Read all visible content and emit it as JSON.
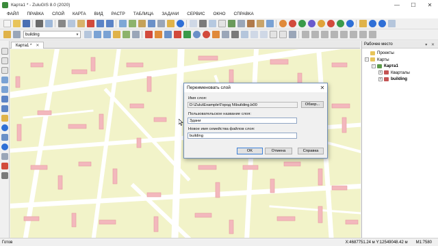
{
  "window": {
    "title": "Карта1 * - ZuluGIS 8.0 (2020)",
    "controls": [
      "—",
      "☐",
      "✕"
    ]
  },
  "menu": [
    "ФАЙЛ",
    "ПРАВКА",
    "СЛОЙ",
    "КАРТА",
    "ВИД",
    "РАСТР",
    "ТАБЛИЦА",
    "ЗАДАЧИ",
    "СЕРВИС",
    "ОКНО",
    "СПРАВКА"
  ],
  "toolbar": {
    "layer_combo_value": "building"
  },
  "tab": {
    "label": "Карта1 *",
    "close": "✕"
  },
  "workspace": {
    "title": "Рабочее место",
    "controls": "▾ ✕",
    "tree": [
      {
        "label": "Проекты",
        "level": 0,
        "toggle": "",
        "icon": "folder-icon"
      },
      {
        "label": "Карты",
        "level": 0,
        "toggle": "−",
        "icon": "folder-icon"
      },
      {
        "label": "Карта1",
        "level": 1,
        "toggle": "−",
        "icon": "map-icon",
        "bold": true
      },
      {
        "label": "Кварталы",
        "level": 2,
        "toggle": "+",
        "icon": "layer-icon"
      },
      {
        "label": "building",
        "level": 2,
        "toggle": "+",
        "icon": "layer-icon",
        "bold": true
      }
    ]
  },
  "dialog": {
    "title": "Переименовать слой",
    "layer_name_label": "Имя слоя:",
    "layer_name_value": "D:\\Zulu\\Example\\Город N\\building.b00",
    "browse_button": "Обзор...",
    "custom_name_label": "Пользовательское название слоя:",
    "custom_name_value": "Здани",
    "new_file_label": "Новое имя семейства файлов слоя:",
    "new_file_value": "building",
    "ok": "OK",
    "cancel": "Отмена",
    "help": "Справка"
  },
  "status": {
    "left": "Готов",
    "coords": "X:4687751.24 м  Y:12549048.42 м",
    "scale": "M1:7580"
  },
  "colors": {
    "map_background": "#f2f3c9",
    "roads": "#ffffff",
    "buildings": "#f3b8bd",
    "building_stroke": "#e79aa0"
  }
}
